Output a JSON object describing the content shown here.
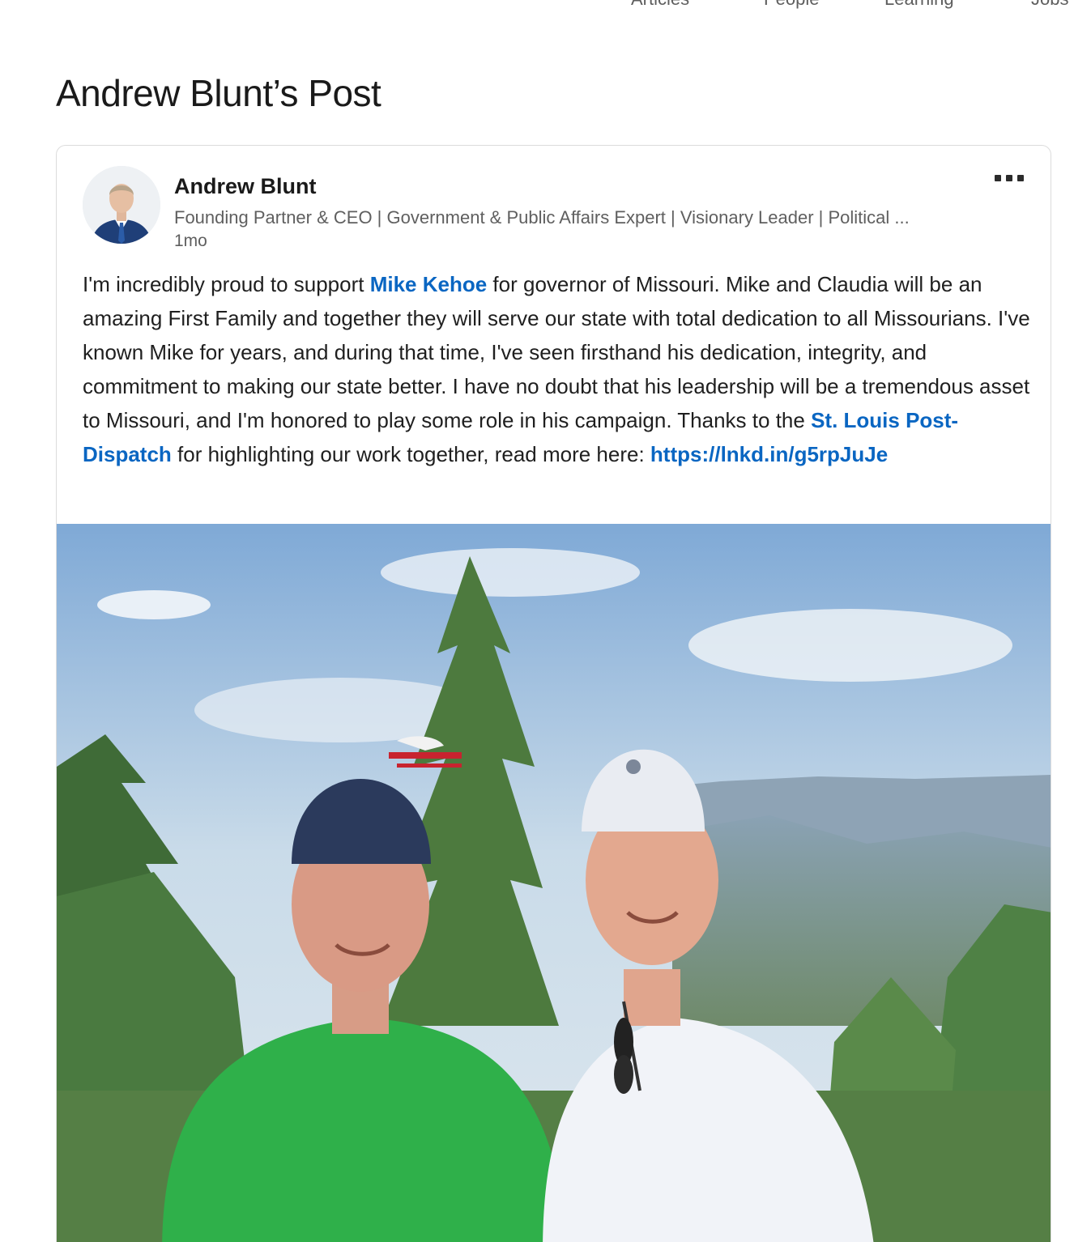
{
  "topnav": {
    "items": [
      "Articles",
      "People",
      "Learning",
      "Jobs"
    ]
  },
  "page": {
    "title": "Andrew Blunt’s Post"
  },
  "post": {
    "author": {
      "name": "Andrew Blunt",
      "headline": "Founding Partner & CEO | Government & Public Affairs Expert | Visionary Leader | Political ...",
      "avatar_icon": "profile-photo"
    },
    "time": "1mo",
    "more_icon": "ellipsis-icon",
    "text": {
      "part1": "I'm incredibly proud to support ",
      "mention1": "Mike Kehoe",
      "part2": " for governor of Missouri. Mike and Claudia will be an amazing First Family and together they will serve our state with total dedication to all Missourians. I've known Mike for years, and during that time, I've seen firsthand his dedication, integrity, and commitment to making our state better. I have no doubt that his leadership will be a tremendous asset to Missouri, and I'm honored to play some role in his campaign. Thanks to the ",
      "mention2": "St. Louis Post-Dispatch",
      "part3": " for highlighting our work together, read more here: ",
      "link": "https://lnkd.in/g5rpJuJe"
    },
    "image": {
      "description_icon": "photo-two-men-outdoors"
    }
  },
  "colors": {
    "link": "#0a66c2",
    "text": "#1f1f1f",
    "secondary": "#5f5f5f",
    "border": "#dcdcdc"
  }
}
